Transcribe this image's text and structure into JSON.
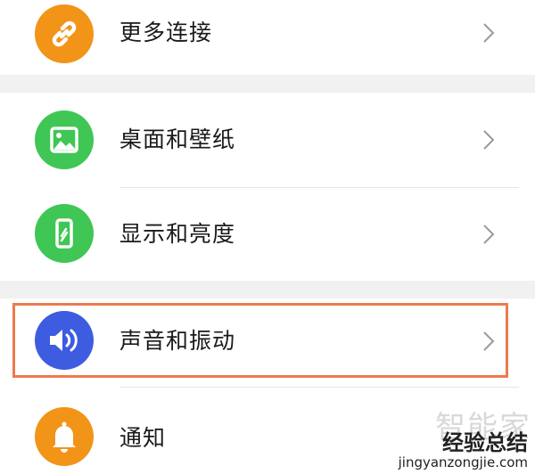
{
  "settings_items": [
    {
      "label": "更多连接",
      "icon": "link-icon",
      "color": "#f29418"
    },
    {
      "label": "桌面和壁纸",
      "icon": "image-icon",
      "color": "#3fc654"
    },
    {
      "label": "显示和亮度",
      "icon": "phone-brightness-icon",
      "color": "#3fc654"
    },
    {
      "label": "声音和振动",
      "icon": "speaker-icon",
      "color": "#3d5ce0"
    },
    {
      "label": "通知",
      "icon": "bell-icon",
      "color": "#f29418"
    }
  ],
  "highlight_color": "#ee7a4e",
  "watermark": {
    "logo_text": "智能家",
    "title_line": "经验总结",
    "url": "jingyanzongjie.com"
  }
}
